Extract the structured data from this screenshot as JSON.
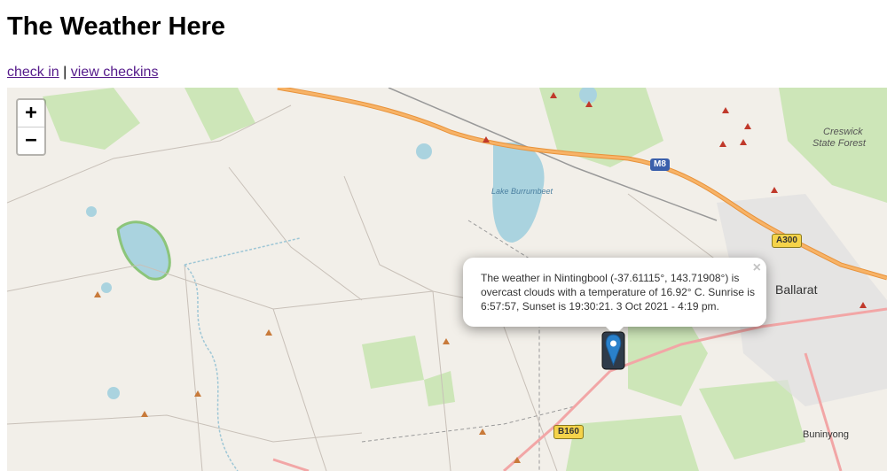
{
  "page": {
    "title": "The Weather Here",
    "nav": {
      "checkin_label": "check in",
      "separator": " | ",
      "view_label": "view checkins"
    }
  },
  "map": {
    "zoom_in": "+",
    "zoom_out": "−",
    "popup": {
      "text": "The weather in Nintingbool (-37.61115°, 143.71908°) is overcast clouds with a temperature of 16.92° C. Sunrise is 6:57:57, Sunset is 19:30:21. 3 Oct 2021 - 4:19 pm.",
      "close": "×"
    },
    "labels": {
      "creswick": "Creswick",
      "creswick_forest": "State Forest",
      "lake": "Lake Burrumbeet",
      "ballarat": "Ballarat",
      "buninyong": "Buninyong"
    },
    "shields": {
      "m8": "M8",
      "a300": "A300",
      "b160": "B160"
    },
    "colors": {
      "land": "#f2efe9",
      "water": "#aad3df",
      "forest": "#cde6b8",
      "motorway": "#f2a64a",
      "popup": "#ffffff",
      "marker": "#2a81cb"
    }
  }
}
